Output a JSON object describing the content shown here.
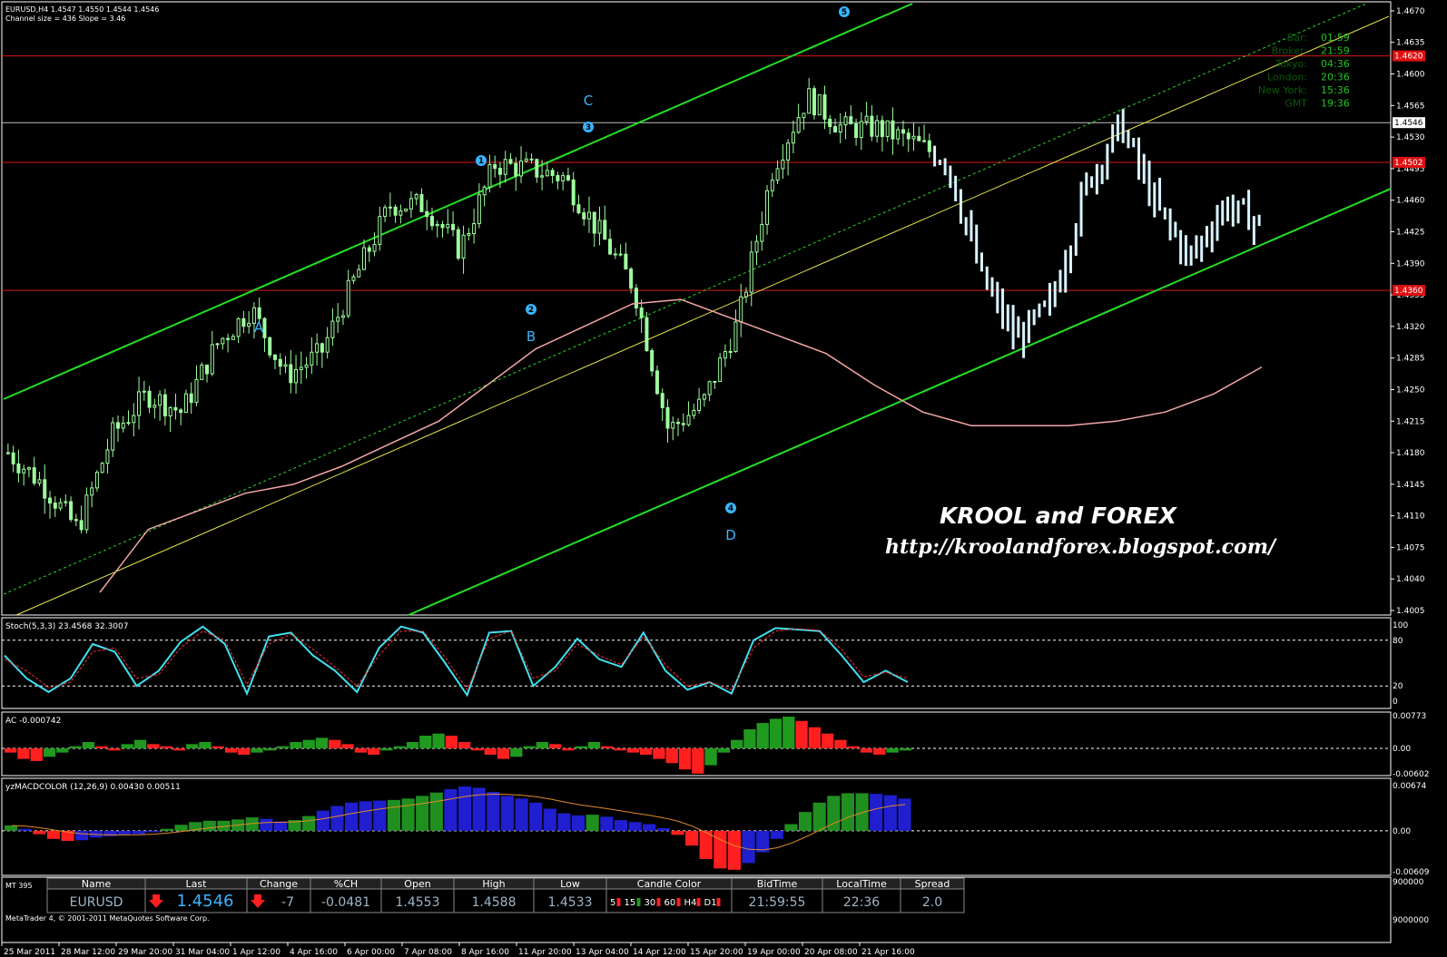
{
  "window": {
    "symbol_header": "EURUSD,H4  1.4547 1.4550 1.4544 1.4546",
    "channel_info": "Channel size = 436 Slope = 3.46",
    "copyright": "MetaTrader 4, © 2001-2011 MetaQuotes Software Corp."
  },
  "watermark": {
    "title": "KROOL and FOREX",
    "url": "http://kroolandforex.blogspot.com/"
  },
  "clock": [
    {
      "label": "Bar:",
      "value": "01:59"
    },
    {
      "label": "Broker:",
      "value": "21:59"
    },
    {
      "label": "Tokyo:",
      "value": "04:36"
    },
    {
      "label": "London:",
      "value": "20:36"
    },
    {
      "label": "New York:",
      "value": "15:36"
    },
    {
      "label": "GMT",
      "value": "19:36"
    }
  ],
  "chart_data": [
    {
      "type": "candlestick",
      "name": "EURUSD,H4",
      "ylim": [
        1.4,
        1.468
      ],
      "y_ticks": [
        "1.4670",
        "1.4635",
        "1.4600",
        "1.4565",
        "1.4530",
        "1.4495",
        "1.4460",
        "1.4425",
        "1.4390",
        "1.4355",
        "1.4320",
        "1.4285",
        "1.4250",
        "1.4215",
        "1.4180",
        "1.4145",
        "1.4110",
        "1.4075",
        "1.4040",
        "1.4005"
      ],
      "price_tags": [
        "1.4620",
        "1.4546",
        "1.4502",
        "1.4360"
      ],
      "horizontal_levels": [
        1.462,
        1.4546,
        1.4502,
        1.436
      ],
      "x_ticks": [
        "25 Mar 2011",
        "28 Mar 12:00",
        "29 Mar 20:00",
        "31 Mar 04:00",
        "1 Apr 12:00",
        "4 Apr 16:00",
        "6 Apr 00:00",
        "7 Apr 08:00",
        "8 Apr 16:00",
        "11 Apr 20:00",
        "13 Apr 04:00",
        "14 Apr 12:00",
        "15 Apr 20:00",
        "19 Apr 00:00",
        "20 Apr 08:00",
        "21 Apr 16:00"
      ],
      "wave_labels": [
        "A",
        "B",
        "C",
        "D",
        "1",
        "2",
        "3",
        "4",
        "5"
      ],
      "key_closes": [
        1.418,
        1.4145,
        1.4095,
        1.42,
        1.4245,
        1.4225,
        1.43,
        1.434,
        1.4265,
        1.429,
        1.4375,
        1.4455,
        1.4455,
        1.4405,
        1.45,
        1.4495,
        1.4485,
        1.4425,
        1.4365,
        1.4205,
        1.4235,
        1.4325,
        1.4495,
        1.4575,
        1.454,
        1.454,
        1.4525,
        1.4505,
        1.4375,
        1.4305,
        1.4345,
        1.4475,
        1.4545,
        1.4455,
        1.4395,
        1.4455,
        1.4435
      ],
      "moving_average": [
        1.4025,
        1.4095,
        1.4115,
        1.4135,
        1.4145,
        1.4165,
        1.419,
        1.4215,
        1.4255,
        1.4295,
        1.432,
        1.4345,
        1.435,
        1.433,
        1.431,
        1.429,
        1.4255,
        1.4225,
        1.421,
        1.421,
        1.421,
        1.4215,
        1.4225,
        1.4245,
        1.4275
      ]
    },
    {
      "type": "line",
      "name": "Stoch(5,3,3)",
      "header": "Stoch(5,3,3) 23.4568 32.3007",
      "ylim": [
        0,
        100
      ],
      "y_ticks": [
        "100",
        "80",
        "20",
        "0"
      ],
      "series": [
        {
          "name": "main",
          "values": [
            60,
            30,
            12,
            30,
            75,
            65,
            20,
            40,
            78,
            98,
            75,
            10,
            85,
            90,
            60,
            40,
            12,
            70,
            98,
            90,
            50,
            8,
            90,
            92,
            20,
            45,
            82,
            55,
            45,
            90,
            40,
            15,
            25,
            10,
            80,
            96,
            94,
            92,
            60,
            25,
            40,
            25
          ]
        },
        {
          "name": "signal",
          "values": [
            55,
            40,
            18,
            25,
            65,
            70,
            30,
            35,
            70,
            92,
            80,
            22,
            75,
            88,
            68,
            45,
            20,
            60,
            92,
            92,
            58,
            15,
            82,
            92,
            30,
            40,
            75,
            60,
            48,
            85,
            48,
            20,
            25,
            15,
            70,
            92,
            95,
            93,
            68,
            32,
            38,
            30
          ]
        }
      ]
    },
    {
      "type": "bar",
      "name": "AC",
      "header": "AC -0.000742",
      "ylim": [
        -0.00602,
        0.00773
      ],
      "y_ticks": [
        "0.00773",
        "0.00",
        "-0.00602"
      ],
      "values": [
        -0.001,
        -0.0025,
        -0.003,
        -0.002,
        -0.001,
        0.0005,
        0.0015,
        0.0005,
        -0.0005,
        0.001,
        0.002,
        0.001,
        0.0005,
        -0.0005,
        0.001,
        0.0015,
        0.0005,
        -0.001,
        -0.0015,
        -0.001,
        -0.0005,
        0.0005,
        0.0015,
        0.002,
        0.0025,
        0.002,
        0.001,
        -0.001,
        -0.0015,
        -0.0005,
        0.0005,
        0.0015,
        0.003,
        0.0035,
        0.003,
        0.0015,
        -0.0005,
        -0.0015,
        -0.0025,
        -0.002,
        0.0005,
        0.0015,
        0.001,
        -0.0005,
        0.0005,
        0.0015,
        0.0005,
        -0.0005,
        -0.001,
        -0.0015,
        -0.0025,
        -0.0035,
        -0.005,
        -0.006,
        -0.004,
        -0.001,
        0.002,
        0.0045,
        0.006,
        0.007,
        0.0075,
        0.0065,
        0.005,
        0.0035,
        0.002,
        0.0005,
        -0.001,
        -0.0015,
        -0.001,
        -0.0005
      ]
    },
    {
      "type": "bar",
      "name": "yzMACDCOLOR (12,26,9)",
      "header": "yzMACDCOLOR (12,26,9) 0.00430 0.00511",
      "ylim": [
        -0.00609,
        0.00674
      ],
      "y_ticks": [
        "0.00674",
        "0.00",
        "-0.00609"
      ],
      "values": [
        0.0008,
        0.0003,
        -0.0005,
        -0.0012,
        -0.0015,
        -0.0014,
        -0.001,
        -0.0008,
        -0.0006,
        -0.0005,
        -0.0002,
        0.0003,
        0.0009,
        0.0013,
        0.0015,
        0.0015,
        0.0017,
        0.002,
        0.0018,
        0.0014,
        0.0016,
        0.0022,
        0.003,
        0.0037,
        0.0042,
        0.0044,
        0.0045,
        0.0046,
        0.0048,
        0.0052,
        0.0057,
        0.0062,
        0.0066,
        0.0064,
        0.0058,
        0.0052,
        0.0048,
        0.0042,
        0.0033,
        0.0026,
        0.0023,
        0.0024,
        0.0021,
        0.0016,
        0.0013,
        0.001,
        0.0004,
        -0.0006,
        -0.0022,
        -0.0042,
        -0.0056,
        -0.0058,
        -0.0048,
        -0.0032,
        -0.0012,
        0.001,
        0.0028,
        0.0042,
        0.0052,
        0.0056,
        0.0056,
        0.0055,
        0.0053,
        0.0048
      ],
      "colors": [
        "#ff1f1f",
        "#1f8f1f",
        "#1f1fcf"
      ]
    }
  ],
  "info_bar": {
    "mt_label": "MT 395",
    "columns": [
      {
        "head": "Name",
        "value": "EURUSD"
      },
      {
        "head": "Last",
        "value": "1.4546"
      },
      {
        "head": "Change",
        "value": "-7"
      },
      {
        "head": "%CH",
        "value": "-0.0481"
      },
      {
        "head": "Open",
        "value": "1.4553"
      },
      {
        "head": "High",
        "value": "1.4588"
      },
      {
        "head": "Low",
        "value": "1.4533"
      },
      {
        "head": "Candle Color",
        "value": ""
      },
      {
        "head": "BidTime",
        "value": "21:59:55"
      },
      {
        "head": "LocalTime",
        "value": "22:36"
      },
      {
        "head": "Spread",
        "value": "2.0"
      }
    ],
    "candle_tfs": [
      "5",
      "15",
      "30",
      "60",
      "H4",
      "D1"
    ],
    "scale_ticks": [
      "900000",
      "9000000"
    ]
  },
  "colors": {
    "background": "#000000",
    "candle": "#9eff9e",
    "candle_bar_recent": "#d8f4ff",
    "channel": "#22e022",
    "midline": "#e8e84a",
    "ma": "#f4a6a6",
    "level": "#d81818",
    "wave": "#3bb4ff",
    "stoch_main": "#40e0f0",
    "stoch_signal": "#ff3030"
  }
}
